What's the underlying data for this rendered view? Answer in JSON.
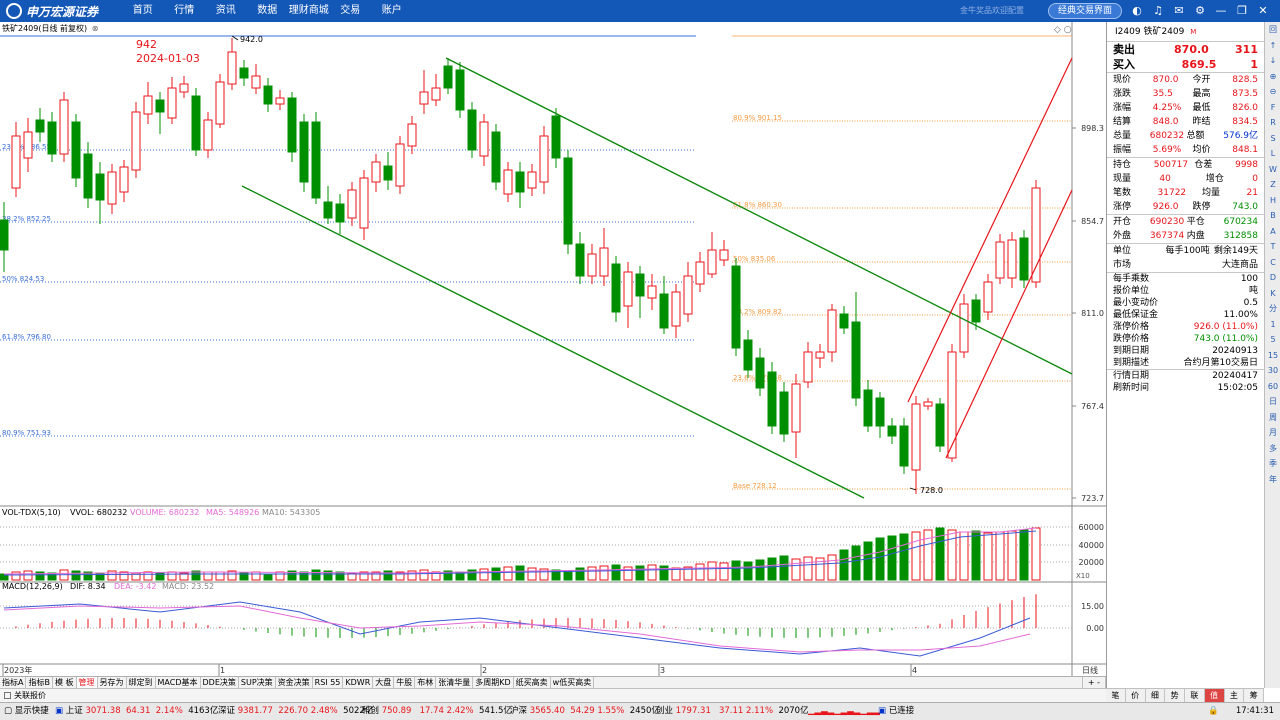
{
  "topbar": {
    "logo_text": "申万宏源证券",
    "menu": [
      "首页",
      "行情",
      "资讯",
      "数据",
      "理财商城",
      "交易",
      "账户"
    ],
    "ghost_text": "金牛奖品欢迎配置",
    "classic_button": "经典交易界面",
    "icons": [
      "skin-icon",
      "headset-icon",
      "mail-icon",
      "settings-icon",
      "minimize-icon",
      "restore-icon",
      "close-icon"
    ]
  },
  "chart": {
    "title": "铁矿2409(日线 前复权)",
    "annotation_price": "942",
    "annotation_date": "2024-01-03",
    "high_label": "942.0",
    "low_label": "728.0",
    "price_ticks": [
      "898.3",
      "854.7",
      "811.0",
      "767.4",
      "723.7"
    ],
    "fib_right": [
      "80.9% 901.15",
      "61.8% 860.30",
      "50% 835.06",
      "38.2% 809.82",
      "23.6% 778.58",
      "Base 728.12"
    ],
    "fib_left": [
      "23.6% 886.55",
      "38.2% 852.25",
      "50% 824.53",
      "61.8% 796.80",
      "80.9% 751.93"
    ],
    "vol_legend": {
      "name": "VOL-TDX(5,10)",
      "vvol": "VVOL: 680232",
      "volume": "VOLUME: 680232",
      "ma5": "MA5: 548926",
      "ma10": "MA10: 543305"
    },
    "vol_ticks": [
      "60000",
      "40000",
      "20000"
    ],
    "vol_unit": "X10",
    "macd_legend": {
      "name": "MACD(12,26,9)",
      "dif": "DIF: 8.34",
      "dea": "DEA: -3.42",
      "macd": "MACD: 23.52"
    },
    "macd_ticks": [
      "15.00",
      "0.00"
    ],
    "date_labels": [
      "2023年",
      "1",
      "2",
      "3",
      "4"
    ],
    "date_axis_label": "日线",
    "colors": {
      "up": "#e8141a",
      "down": "#008f00",
      "channel_green": "#0f8a0f",
      "channel_red": "#e8141a",
      "fib_blue": "#3a6fd6",
      "fib_orange": "#f39c45",
      "ma5": "#e36ad6",
      "ma10": "#3a5ad6"
    }
  },
  "quote": {
    "header_code": "I2409",
    "header_name": "铁矿2409",
    "header_badge": "M",
    "sell_label": "卖出",
    "sell_price": "870.0",
    "sell_qty": "311",
    "buy_label": "买入",
    "buy_price": "869.5",
    "buy_qty": "1",
    "rows_a": [
      [
        "现价",
        "870.0",
        "今开",
        "828.5"
      ],
      [
        "涨跌",
        "35.5",
        "最高",
        "873.5"
      ],
      [
        "涨幅",
        "4.25%",
        "最低",
        "826.0"
      ],
      [
        "结算",
        "848.0",
        "昨结",
        "834.5"
      ],
      [
        "总量",
        "680232",
        "总额",
        "576.9亿"
      ],
      [
        "振幅",
        "5.69%",
        "均价",
        "848.1"
      ]
    ],
    "rows_b": [
      [
        "持仓",
        "500717",
        "仓差",
        "9998"
      ],
      [
        "现量",
        "40",
        "增仓",
        "0"
      ],
      [
        "笔数",
        "31722",
        "均量",
        "21"
      ],
      [
        "涨停",
        "926.0",
        "跌停",
        "743.0"
      ]
    ],
    "rows_c": [
      [
        "开仓",
        "690230",
        "平仓",
        "670234"
      ],
      [
        "外盘",
        "367374",
        "内盘",
        "312858"
      ]
    ],
    "unit_label": "单位",
    "unit_value": "每手100吨",
    "remain": "剩余149天",
    "market_label": "市场",
    "market_value": "大连商品",
    "info": [
      [
        "每手乘数",
        "100"
      ],
      [
        "报价单位",
        "吨"
      ],
      [
        "最小变动价",
        "0.5"
      ],
      [
        "最低保证金",
        "11.00%"
      ],
      [
        "涨停价格",
        "926.0 (11.0%)"
      ],
      [
        "跌停价格",
        "743.0 (11.0%)"
      ],
      [
        "到期日期",
        "20240913"
      ],
      [
        "到期描述",
        "合约月第10交易日"
      ]
    ],
    "info2": [
      [
        "行情日期",
        "20240417"
      ],
      [
        "刷新时间",
        "15:02:05"
      ]
    ]
  },
  "side_icons": [
    "回",
    "↑",
    "↓",
    "⊕",
    "⊖",
    "F",
    "R",
    "S",
    "L",
    "W",
    "Z",
    "H",
    "B",
    "A",
    "T",
    "C",
    "D",
    "K",
    "分",
    "1",
    "5",
    "15",
    "30",
    "60",
    "日",
    "周",
    "月",
    "多",
    "季",
    "年"
  ],
  "tabs": [
    "指标A",
    "指标B",
    "模 板",
    "管理",
    "另存为",
    "绑定到",
    "MACD基本",
    "DDE决策",
    "SUP决策",
    "资金决策",
    "RSI 55",
    "KDWR",
    "大盘",
    "牛股",
    "布林",
    "张清华量",
    "多周期KD",
    "纸买高卖",
    "w低买高卖"
  ],
  "tab_arrows": "+ -",
  "assoc_label": "关联报价",
  "right_tabs": [
    "笔",
    "价",
    "细",
    "势",
    "联",
    "值",
    "主",
    "筹"
  ],
  "status": {
    "show_speed": "显示快捷",
    "sh_label": "上证",
    "sh_val": "3071.38",
    "sh_chg": "64.31",
    "sh_pct": "2.14%",
    "sh_amt": "4163亿",
    "sz_label": "深证",
    "sz_val": "9381.77",
    "sz_chg": "226.70",
    "sz_pct": "2.48%",
    "sz_amt": "5022亿",
    "kc_label": "科创",
    "kc_val": "750.89",
    "kc_chg": "17.74",
    "kc_pct": "2.42%",
    "kc_amt": "541.5亿",
    "hs_label": "沪深",
    "hs_val": "3565.40",
    "hs_chg": "54.29",
    "hs_pct": "1.55%",
    "hs_amt": "2450亿",
    "cy_label": "创业",
    "cy_val": "1797.31",
    "cy_chg": "37.11",
    "cy_pct": "2.11%",
    "cy_amt": "2070亿",
    "conn": "已连接",
    "time": "17:41:31"
  }
}
